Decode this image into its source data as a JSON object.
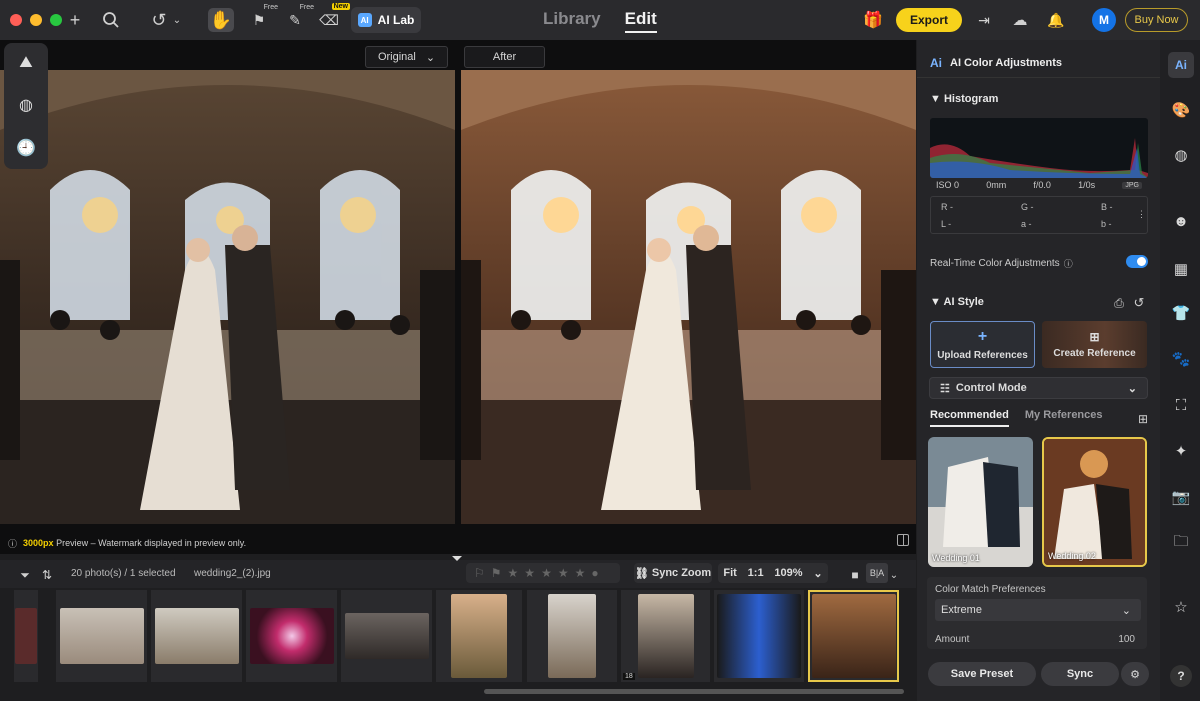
{
  "window": {
    "modes": [
      "Library",
      "Edit"
    ],
    "active_mode": "Edit",
    "export_label": "Export",
    "buy_label": "Buy Now",
    "avatar_letter": "M",
    "ailab_label": "AI Lab",
    "free_badge": "Free",
    "new_badge": "New"
  },
  "viewer": {
    "original_label": "Original",
    "after_label": "After",
    "preview_px": "3000px",
    "preview_text": "Preview – Watermark displayed in preview only."
  },
  "filmstrip": {
    "count_text": "20 photo(s) / 1 selected",
    "filename": "wedding2_(2).jpg",
    "sync_zoom": "Sync Zoom",
    "fit": "Fit",
    "one_to_one": "1:1",
    "zoom": "109%",
    "thumb_badge": "18"
  },
  "panel": {
    "title": "AI Color Adjustments",
    "histogram_title": "Histogram",
    "exif": {
      "iso": "ISO 0",
      "focal": "0mm",
      "aperture": "f/0.0",
      "shutter": "1/0s",
      "format": "JPG"
    },
    "rgb": {
      "r": "R -",
      "g": "G -",
      "b": "B -",
      "l": "L -",
      "a": "a -",
      "b2": "b -"
    },
    "realtime_label": "Real-Time Color Adjustments",
    "ai_style_title": "AI Style",
    "upload_label": "Upload References",
    "create_label": "Create Reference",
    "control_mode": "Control Mode",
    "tabs": [
      "Recommended",
      "My References"
    ],
    "styles": [
      "Wedding 01",
      "Wedding 02"
    ],
    "prefs_title": "Color Match Preferences",
    "prefs_value": "Extreme",
    "amount_label": "Amount",
    "amount_value": "100",
    "save_preset": "Save Preset",
    "sync": "Sync"
  },
  "colors": {
    "accent": "#f7d21b",
    "toggle": "#2f8cf0",
    "selection": "#e7c84a"
  }
}
